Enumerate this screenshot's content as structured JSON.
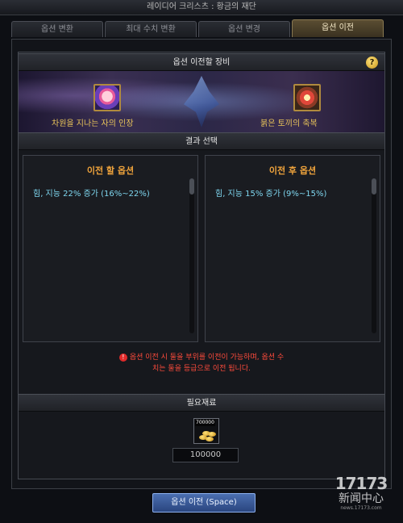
{
  "window": {
    "title": "레이디어 크리스츠 : 황금의 재단"
  },
  "tabs": [
    {
      "label": "옵션 변환",
      "active": false
    },
    {
      "label": "최대 수치 변환",
      "active": false
    },
    {
      "label": "옵션 변경",
      "active": false
    },
    {
      "label": "옵션 이전",
      "active": true
    }
  ],
  "equipment_section": {
    "title": "옵션 이전할 장비",
    "help_label": "?",
    "items": [
      {
        "name": "차원을 지나는 자의 인장",
        "icon": "doll-icon"
      },
      {
        "name": "붉은 토끼의 축복",
        "icon": "blessing-icon"
      }
    ]
  },
  "result_section": {
    "title": "결과 선택",
    "before": {
      "title": "이전 할 옵션",
      "option": "힘, 지능 22% 증가 (16%~22%)"
    },
    "after": {
      "title": "이전 후 옵션",
      "option": "힘, 지능 15% 증가 (9%~15%)"
    }
  },
  "warning": {
    "icon": "!",
    "line1": "옵션 이전 시 둘을 부위를 이전이 가능하며, 옵션 수",
    "line2": "치는 둘을 등급으로 이전 됩니다."
  },
  "materials": {
    "title": "필요재료",
    "item_label": "700000",
    "quantity": "100000",
    "icon": "gold-coins-icon"
  },
  "action": {
    "label": "옵션 이전 (Space)"
  },
  "watermark": {
    "brand": "17173",
    "sub": "新闻中心",
    "url": "news.17173.com"
  },
  "colors": {
    "accent_gold": "#e9c45a",
    "option_title": "#f2a53c",
    "option_text": "#7fd7f0",
    "warning": "#ff4b3c",
    "button": "#2a457f"
  }
}
